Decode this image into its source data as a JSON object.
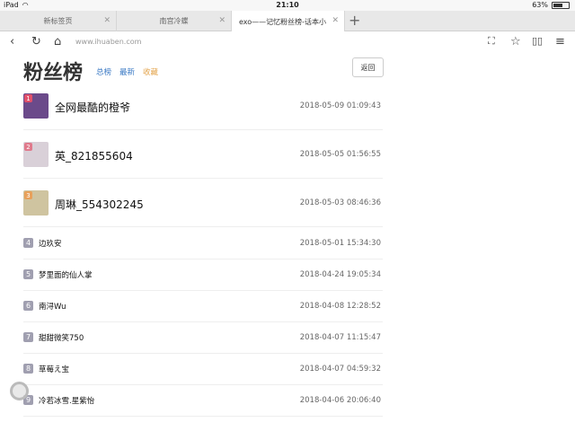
{
  "status_bar": {
    "device": "iPad",
    "time": "21:10",
    "battery": "63%",
    "battery_level": 0.63
  },
  "tabs": [
    {
      "label": "新标签页"
    },
    {
      "label": "南宫冷蝶"
    },
    {
      "label": "exo——记忆粉丝榜-话本小"
    }
  ],
  "toolbar": {
    "url": "www.ihuaben.com"
  },
  "page": {
    "title": "粉丝榜",
    "links": {
      "total": "总榜",
      "latest": "最新",
      "favorites": "收藏"
    },
    "back": "返回"
  },
  "top_fans": [
    {
      "rank": "1",
      "name": "全网最酷的橙爷",
      "date": "2018-05-09 01:09:43",
      "badge_color": "#e0506a",
      "avatar_color": "#6b4a8a"
    },
    {
      "rank": "2",
      "name": "英_821855604",
      "date": "2018-05-05 01:56:55",
      "badge_color": "#e07a8c",
      "avatar_color": "#d9d0d8"
    },
    {
      "rank": "3",
      "name": "周琳_554302245",
      "date": "2018-05-03 08:46:36",
      "badge_color": "#e8a05a",
      "avatar_color": "#cfc4a0"
    }
  ],
  "fans": [
    {
      "rank": "4",
      "name": "边玖安",
      "date": "2018-05-01 15:34:30"
    },
    {
      "rank": "5",
      "name": "梦里面的仙人掌",
      "date": "2018-04-24 19:05:34"
    },
    {
      "rank": "6",
      "name": "南浔Wu",
      "date": "2018-04-08 12:28:52"
    },
    {
      "rank": "7",
      "name": "甜甜微笑750",
      "date": "2018-04-07 11:15:47"
    },
    {
      "rank": "8",
      "name": "草莓え宝",
      "date": "2018-04-07 04:59:32"
    },
    {
      "rank": "9",
      "name": "冷若冰雪.星紫怡",
      "date": "2018-04-06 20:06:40"
    }
  ]
}
